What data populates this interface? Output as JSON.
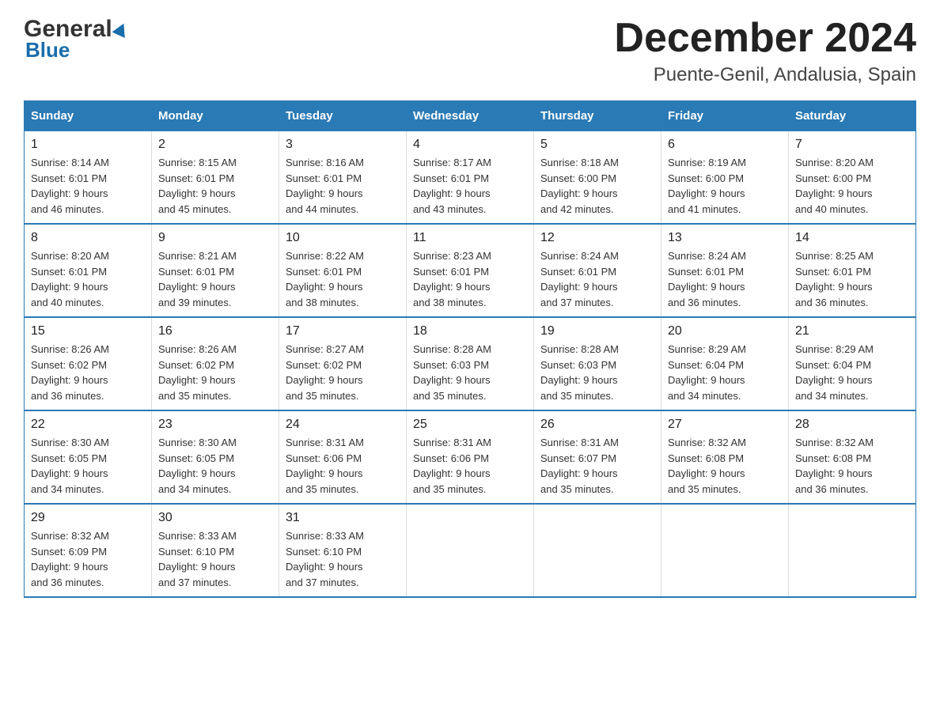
{
  "header": {
    "logo_general": "General",
    "logo_blue": "Blue",
    "title": "December 2024",
    "subtitle": "Puente-Genil, Andalusia, Spain"
  },
  "days_of_week": [
    "Sunday",
    "Monday",
    "Tuesday",
    "Wednesday",
    "Thursday",
    "Friday",
    "Saturday"
  ],
  "weeks": [
    [
      {
        "day": "1",
        "sunrise": "8:14 AM",
        "sunset": "6:01 PM",
        "daylight": "9 hours and 46 minutes."
      },
      {
        "day": "2",
        "sunrise": "8:15 AM",
        "sunset": "6:01 PM",
        "daylight": "9 hours and 45 minutes."
      },
      {
        "day": "3",
        "sunrise": "8:16 AM",
        "sunset": "6:01 PM",
        "daylight": "9 hours and 44 minutes."
      },
      {
        "day": "4",
        "sunrise": "8:17 AM",
        "sunset": "6:01 PM",
        "daylight": "9 hours and 43 minutes."
      },
      {
        "day": "5",
        "sunrise": "8:18 AM",
        "sunset": "6:00 PM",
        "daylight": "9 hours and 42 minutes."
      },
      {
        "day": "6",
        "sunrise": "8:19 AM",
        "sunset": "6:00 PM",
        "daylight": "9 hours and 41 minutes."
      },
      {
        "day": "7",
        "sunrise": "8:20 AM",
        "sunset": "6:00 PM",
        "daylight": "9 hours and 40 minutes."
      }
    ],
    [
      {
        "day": "8",
        "sunrise": "8:20 AM",
        "sunset": "6:01 PM",
        "daylight": "9 hours and 40 minutes."
      },
      {
        "day": "9",
        "sunrise": "8:21 AM",
        "sunset": "6:01 PM",
        "daylight": "9 hours and 39 minutes."
      },
      {
        "day": "10",
        "sunrise": "8:22 AM",
        "sunset": "6:01 PM",
        "daylight": "9 hours and 38 minutes."
      },
      {
        "day": "11",
        "sunrise": "8:23 AM",
        "sunset": "6:01 PM",
        "daylight": "9 hours and 38 minutes."
      },
      {
        "day": "12",
        "sunrise": "8:24 AM",
        "sunset": "6:01 PM",
        "daylight": "9 hours and 37 minutes."
      },
      {
        "day": "13",
        "sunrise": "8:24 AM",
        "sunset": "6:01 PM",
        "daylight": "9 hours and 36 minutes."
      },
      {
        "day": "14",
        "sunrise": "8:25 AM",
        "sunset": "6:01 PM",
        "daylight": "9 hours and 36 minutes."
      }
    ],
    [
      {
        "day": "15",
        "sunrise": "8:26 AM",
        "sunset": "6:02 PM",
        "daylight": "9 hours and 36 minutes."
      },
      {
        "day": "16",
        "sunrise": "8:26 AM",
        "sunset": "6:02 PM",
        "daylight": "9 hours and 35 minutes."
      },
      {
        "day": "17",
        "sunrise": "8:27 AM",
        "sunset": "6:02 PM",
        "daylight": "9 hours and 35 minutes."
      },
      {
        "day": "18",
        "sunrise": "8:28 AM",
        "sunset": "6:03 PM",
        "daylight": "9 hours and 35 minutes."
      },
      {
        "day": "19",
        "sunrise": "8:28 AM",
        "sunset": "6:03 PM",
        "daylight": "9 hours and 35 minutes."
      },
      {
        "day": "20",
        "sunrise": "8:29 AM",
        "sunset": "6:04 PM",
        "daylight": "9 hours and 34 minutes."
      },
      {
        "day": "21",
        "sunrise": "8:29 AM",
        "sunset": "6:04 PM",
        "daylight": "9 hours and 34 minutes."
      }
    ],
    [
      {
        "day": "22",
        "sunrise": "8:30 AM",
        "sunset": "6:05 PM",
        "daylight": "9 hours and 34 minutes."
      },
      {
        "day": "23",
        "sunrise": "8:30 AM",
        "sunset": "6:05 PM",
        "daylight": "9 hours and 34 minutes."
      },
      {
        "day": "24",
        "sunrise": "8:31 AM",
        "sunset": "6:06 PM",
        "daylight": "9 hours and 35 minutes."
      },
      {
        "day": "25",
        "sunrise": "8:31 AM",
        "sunset": "6:06 PM",
        "daylight": "9 hours and 35 minutes."
      },
      {
        "day": "26",
        "sunrise": "8:31 AM",
        "sunset": "6:07 PM",
        "daylight": "9 hours and 35 minutes."
      },
      {
        "day": "27",
        "sunrise": "8:32 AM",
        "sunset": "6:08 PM",
        "daylight": "9 hours and 35 minutes."
      },
      {
        "day": "28",
        "sunrise": "8:32 AM",
        "sunset": "6:08 PM",
        "daylight": "9 hours and 36 minutes."
      }
    ],
    [
      {
        "day": "29",
        "sunrise": "8:32 AM",
        "sunset": "6:09 PM",
        "daylight": "9 hours and 36 minutes."
      },
      {
        "day": "30",
        "sunrise": "8:33 AM",
        "sunset": "6:10 PM",
        "daylight": "9 hours and 37 minutes."
      },
      {
        "day": "31",
        "sunrise": "8:33 AM",
        "sunset": "6:10 PM",
        "daylight": "9 hours and 37 minutes."
      },
      null,
      null,
      null,
      null
    ]
  ]
}
